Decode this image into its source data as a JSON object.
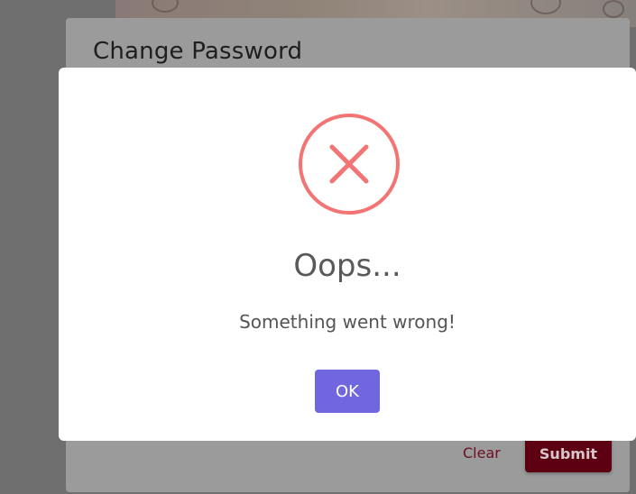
{
  "change_password_dialog": {
    "title": "Change Password",
    "clear_label": "Clear",
    "submit_label": "Submit"
  },
  "alert": {
    "icon": "error-x-icon",
    "title": "Oops...",
    "text": "Something went wrong!",
    "ok_label": "OK"
  },
  "colors": {
    "error": "#f27474",
    "confirm_button": "#7066e0",
    "submit_button": "#5c0012",
    "overlay": "rgba(0,0,0,0.4)"
  }
}
